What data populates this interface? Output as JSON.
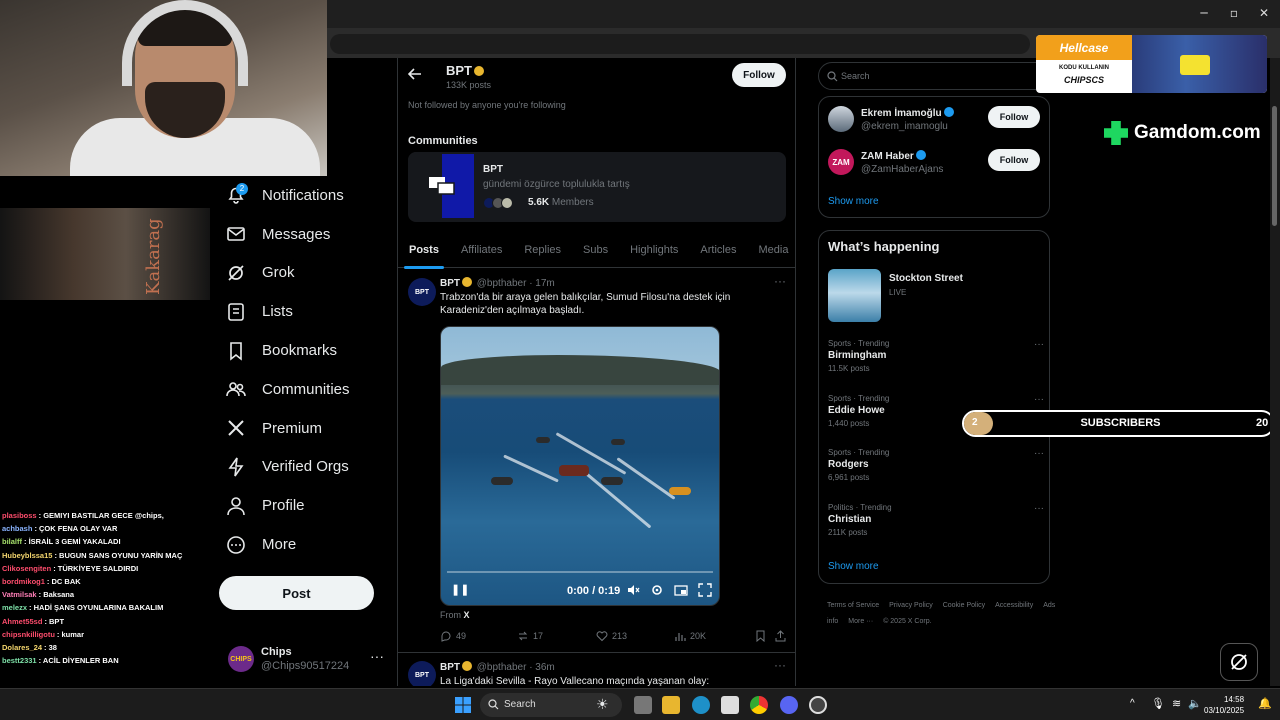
{
  "sidebar": {
    "notification_count": "2",
    "items": [
      {
        "label": "Notifications",
        "icon": "bell-icon"
      },
      {
        "label": "Messages",
        "icon": "envelope-icon"
      },
      {
        "label": "Grok",
        "icon": "grok-icon"
      },
      {
        "label": "Lists",
        "icon": "list-icon"
      },
      {
        "label": "Bookmarks",
        "icon": "bookmark-icon"
      },
      {
        "label": "Communities",
        "icon": "people-icon"
      },
      {
        "label": "Premium",
        "icon": "x-logo-icon"
      },
      {
        "label": "Verified Orgs",
        "icon": "lightning-icon"
      },
      {
        "label": "Profile",
        "icon": "person-icon"
      },
      {
        "label": "More",
        "icon": "more-circle-icon"
      }
    ],
    "post_label": "Post",
    "account": {
      "avatar_text": "CHIPS",
      "name": "Chips",
      "handle": "@Chips90517224"
    }
  },
  "profile": {
    "name": "BPT",
    "posts_count": "133K posts",
    "follow_label": "Follow",
    "not_followed": "Not followed by anyone you're following"
  },
  "communities": {
    "title": "Communities",
    "name": "BPT",
    "description": "gündemi özgürce toplulukla tartış",
    "members_count": "5.6K",
    "members_label": "Members"
  },
  "tabs": [
    "Posts",
    "Affiliates",
    "Replies",
    "Subs",
    "Highlights",
    "Articles",
    "Media"
  ],
  "tweets": [
    {
      "avatar_text": "BPT",
      "name": "BPT",
      "handle": "@bpthaber",
      "time": "· 17m",
      "text": "Trabzon'da bir araya gelen balıkçılar, Sumud Filosu'na destek için Karadeniz'den açılmaya başladı.",
      "video_time": "0:00 / 0:19",
      "from_label": "From",
      "from_source": "X",
      "replies": "49",
      "reposts": "17",
      "likes": "213",
      "views": "20K"
    },
    {
      "avatar_text": "BPT",
      "name": "BPT",
      "handle": "@bpthaber",
      "time": "· 36m",
      "text": "La Liga'daki Sevilla - Rayo Vallecano maçında yaşanan olay:"
    }
  ],
  "search": {
    "placeholder": "Search"
  },
  "who_to_follow": [
    {
      "name": "Ekrem İmamoğlu",
      "handle": "@ekrem_imamoglu",
      "follow_label": "Follow"
    },
    {
      "name": "ZAM Haber",
      "handle": "@ZamHaberAjans",
      "follow_label": "Follow",
      "avatar_text": "ZAM"
    }
  ],
  "show_more": "Show more",
  "happening": {
    "title": "What’s happening",
    "feature": {
      "name": "Stockton Street",
      "status": "LIVE"
    },
    "trends": [
      {
        "category": "Sports · Trending",
        "name": "Birmingham",
        "count": "11.5K posts"
      },
      {
        "category": "Sports · Trending",
        "name": "Eddie Howe",
        "count": "1,440 posts"
      },
      {
        "category": "Sports · Trending",
        "name": "Rodgers",
        "count": "6,961 posts"
      },
      {
        "category": "Politics · Trending",
        "name": "Christian",
        "count": "211K posts"
      }
    ],
    "show_more": "Show more"
  },
  "footer": {
    "links": [
      "Terms of Service",
      "Privacy Policy",
      "Cookie Policy",
      "Accessibility",
      "Ads info",
      "More ···",
      "© 2025 X Corp."
    ]
  },
  "chat": [
    {
      "user": "plasiboss",
      "color": "#ff4d6d",
      "msg": ": GEMIYI BASTILAR GECE @chips,"
    },
    {
      "user": "achbash",
      "color": "#8ab4ff",
      "msg": ": ÇOK FENA OLAY VAR"
    },
    {
      "user": "bilalff",
      "color": "#a6e06b",
      "msg": ": İSRAİL 3 GEMİ YAKALADI"
    },
    {
      "user": "Hubeyblssa15",
      "color": "#f5d76e",
      "msg": ": BUGUN SANS OYUNU YARİN MAÇ"
    },
    {
      "user": "Clikosengiten",
      "color": "#ff4d6d",
      "msg": ": TÜRKİYEYE SALDIRDI"
    },
    {
      "user": "bordmikog1",
      "color": "#ff4d6d",
      "msg": ": DC BAK"
    },
    {
      "user": "Vatmilsak",
      "color": "#ff7eb6",
      "msg": ": Baksana"
    },
    {
      "user": "melezx",
      "color": "#7ee0a8",
      "msg": ": HADİ ŞANS OYUNLARINA BAKALIM"
    },
    {
      "user": "Ahmet55sd",
      "color": "#ff4d6d",
      "msg": ": BPT"
    },
    {
      "user": "chipsnkilligotu",
      "color": "#ff4d6d",
      "msg": ": kumar"
    },
    {
      "user": "Dolares_24",
      "color": "#f5d76e",
      "msg": ": 38"
    },
    {
      "user": "bestt2331",
      "color": "#7ee0a8",
      "msg": ": ACİL DİYENLER BAN"
    }
  ],
  "overlays": {
    "hellcase_brand": "Hellcase",
    "hellcase_line1": "KODU KULLANIN",
    "hellcase_code": "CHIPSCS",
    "gamdom": "Gamdom.com",
    "subs_current": "2",
    "subs_label": "SUBSCRIBERS",
    "subs_goal": "20",
    "subs_fraction": 0.1,
    "wall_text": "Kakarag"
  },
  "taskbar": {
    "search_placeholder": "Search",
    "time": "14:58",
    "date": "03/10/2025"
  }
}
